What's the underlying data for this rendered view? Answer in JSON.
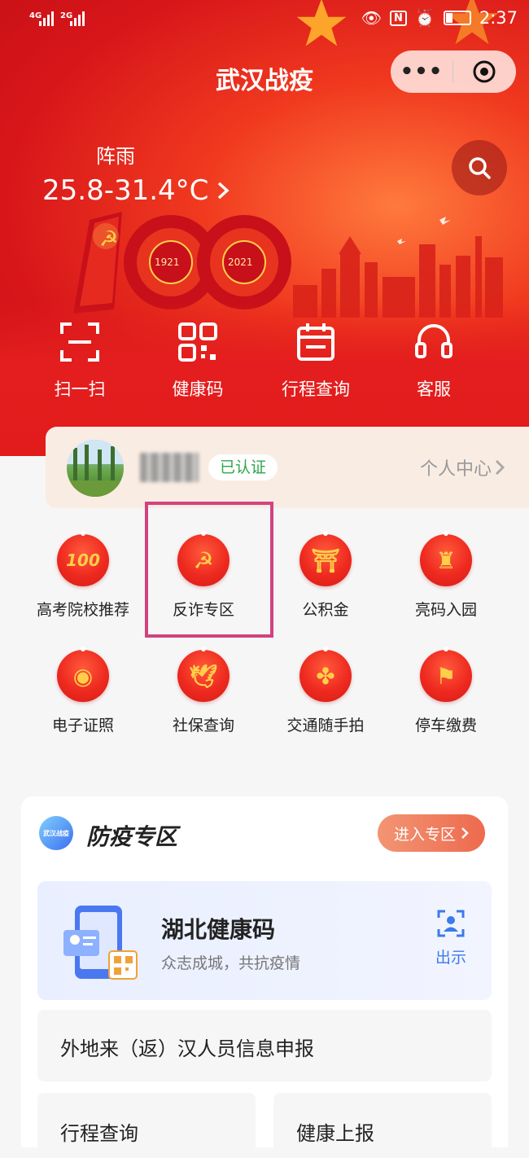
{
  "status_bar": {
    "signal1": "4G",
    "signal2": "2G",
    "time": "2:37"
  },
  "header": {
    "title": "武汉战疫",
    "more_icon": "more-dots-icon",
    "close_icon": "target-close-icon"
  },
  "weather": {
    "condition": "阵雨",
    "temp_range": "25.8-31.4°C"
  },
  "banner": {
    "year_left": "1921",
    "year_right": "2021"
  },
  "quick_actions": [
    {
      "label": "扫一扫",
      "icon": "scan-icon"
    },
    {
      "label": "健康码",
      "icon": "qr-code-icon"
    },
    {
      "label": "行程查询",
      "icon": "calendar-icon"
    },
    {
      "label": "客服",
      "icon": "headset-icon"
    }
  ],
  "user": {
    "verified_label": "已认证",
    "center_label": "个人中心"
  },
  "services": [
    {
      "label": "高考院校推荐",
      "glyph": "100"
    },
    {
      "label": "反诈专区",
      "glyph": "☭"
    },
    {
      "label": "公积金",
      "glyph": "⛩"
    },
    {
      "label": "亮码入园",
      "glyph": "♜"
    },
    {
      "label": "电子证照",
      "glyph": "◉"
    },
    {
      "label": "社保查询",
      "glyph": "🕊"
    },
    {
      "label": "交通随手拍",
      "glyph": "✤"
    },
    {
      "label": "停车缴费",
      "glyph": "⚑"
    }
  ],
  "epidemic": {
    "logo_text": "武汉战疫",
    "title": "防疫专区",
    "enter_label": "进入专区",
    "health_code": {
      "title": "湖北健康码",
      "subtitle": "众志成城，共抗疫情",
      "show_label": "出示"
    },
    "items": [
      "外地来（返）汉人员信息申报",
      "行程查询",
      "健康上报"
    ]
  },
  "colors": {
    "brand_red": "#e21b1b",
    "accent_orange": "#ee6a4e",
    "verified_green": "#2ca84a",
    "link_blue": "#3b7bea",
    "highlight_pink": "#d1437f"
  }
}
